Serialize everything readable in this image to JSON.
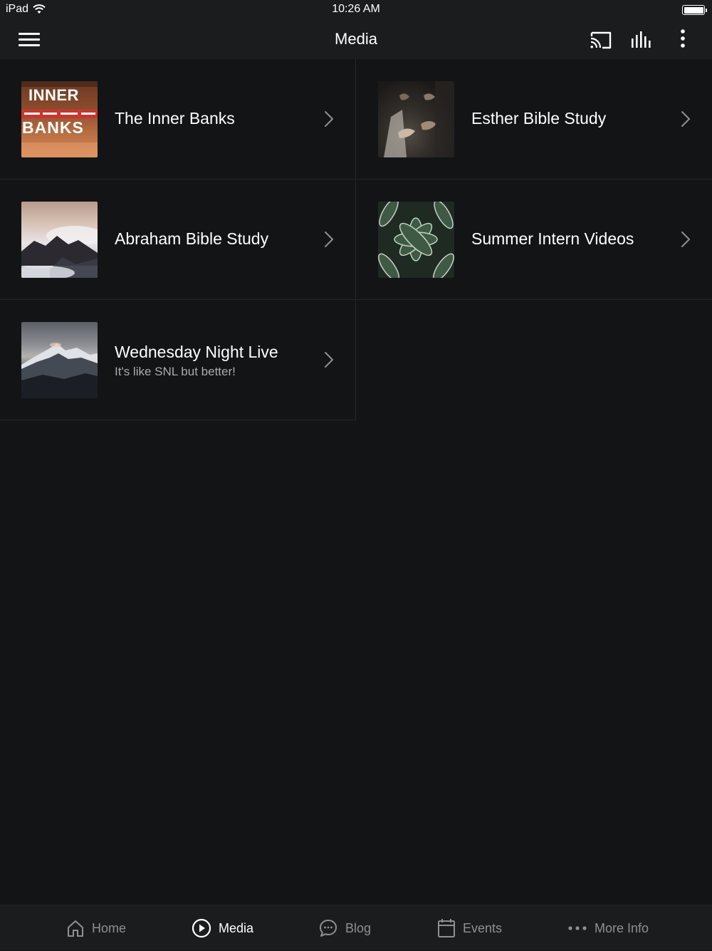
{
  "status_bar": {
    "device": "iPad",
    "time": "10:26 AM"
  },
  "nav": {
    "title": "Media"
  },
  "items": [
    {
      "title": "The Inner Banks",
      "subtitle": "",
      "thumb_text_top": "INNER",
      "thumb_text_bottom": "BANKS"
    },
    {
      "title": "Esther Bible Study",
      "subtitle": ""
    },
    {
      "title": "Abraham Bible Study",
      "subtitle": ""
    },
    {
      "title": "Summer Intern Videos",
      "subtitle": ""
    },
    {
      "title": "Wednesday Night Live",
      "subtitle": "It's like SNL but better!"
    }
  ],
  "tabs": [
    {
      "label": "Home",
      "icon": "home-icon"
    },
    {
      "label": "Media",
      "icon": "play-circle-icon",
      "active": true
    },
    {
      "label": "Blog",
      "icon": "chat-bubble-icon"
    },
    {
      "label": "Events",
      "icon": "calendar-icon"
    },
    {
      "label": "More Info",
      "icon": "more-dots-icon"
    }
  ],
  "colors": {
    "background": "#131416",
    "bar": "#1b1c1e",
    "divider": "#24262a",
    "inactive_tab": "#8e9093"
  }
}
